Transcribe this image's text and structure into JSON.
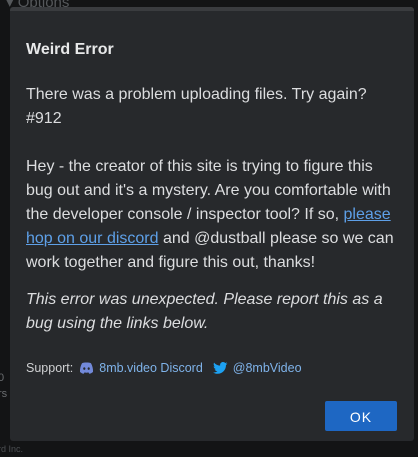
{
  "background": {
    "options_label": "▾ Options",
    "number_fragment": "0",
    "rs_fragment": "rs",
    "footer_fragment": "rd Inc."
  },
  "dialog": {
    "title": "Weird Error",
    "message_line": "There was a problem uploading files. Try again? #912",
    "explanation": {
      "before_link": "Hey - the creator of this site is trying to figure this bug out and it's a mystery. Are you comfortable with the developer console / inspector tool? If so, ",
      "link_text": "please hop on our discord",
      "after_link": " and @dustball please so we can work together and figure this out, thanks!"
    },
    "unexpected_note": "This error was unexpected. Please report this as a bug using the links below.",
    "support": {
      "label": "Support:",
      "discord_icon": "discord-icon",
      "discord_link": "8mb.video Discord",
      "twitter_icon": "twitter-icon",
      "twitter_link": "@8mbVideo"
    },
    "ok_label": "OK"
  },
  "colors": {
    "dialog_bg": "#27292c",
    "button_bg": "#1e67c3",
    "link": "#5ea0e8",
    "twitter_blue": "#1da1f2",
    "discord_blurple": "#7289da"
  }
}
